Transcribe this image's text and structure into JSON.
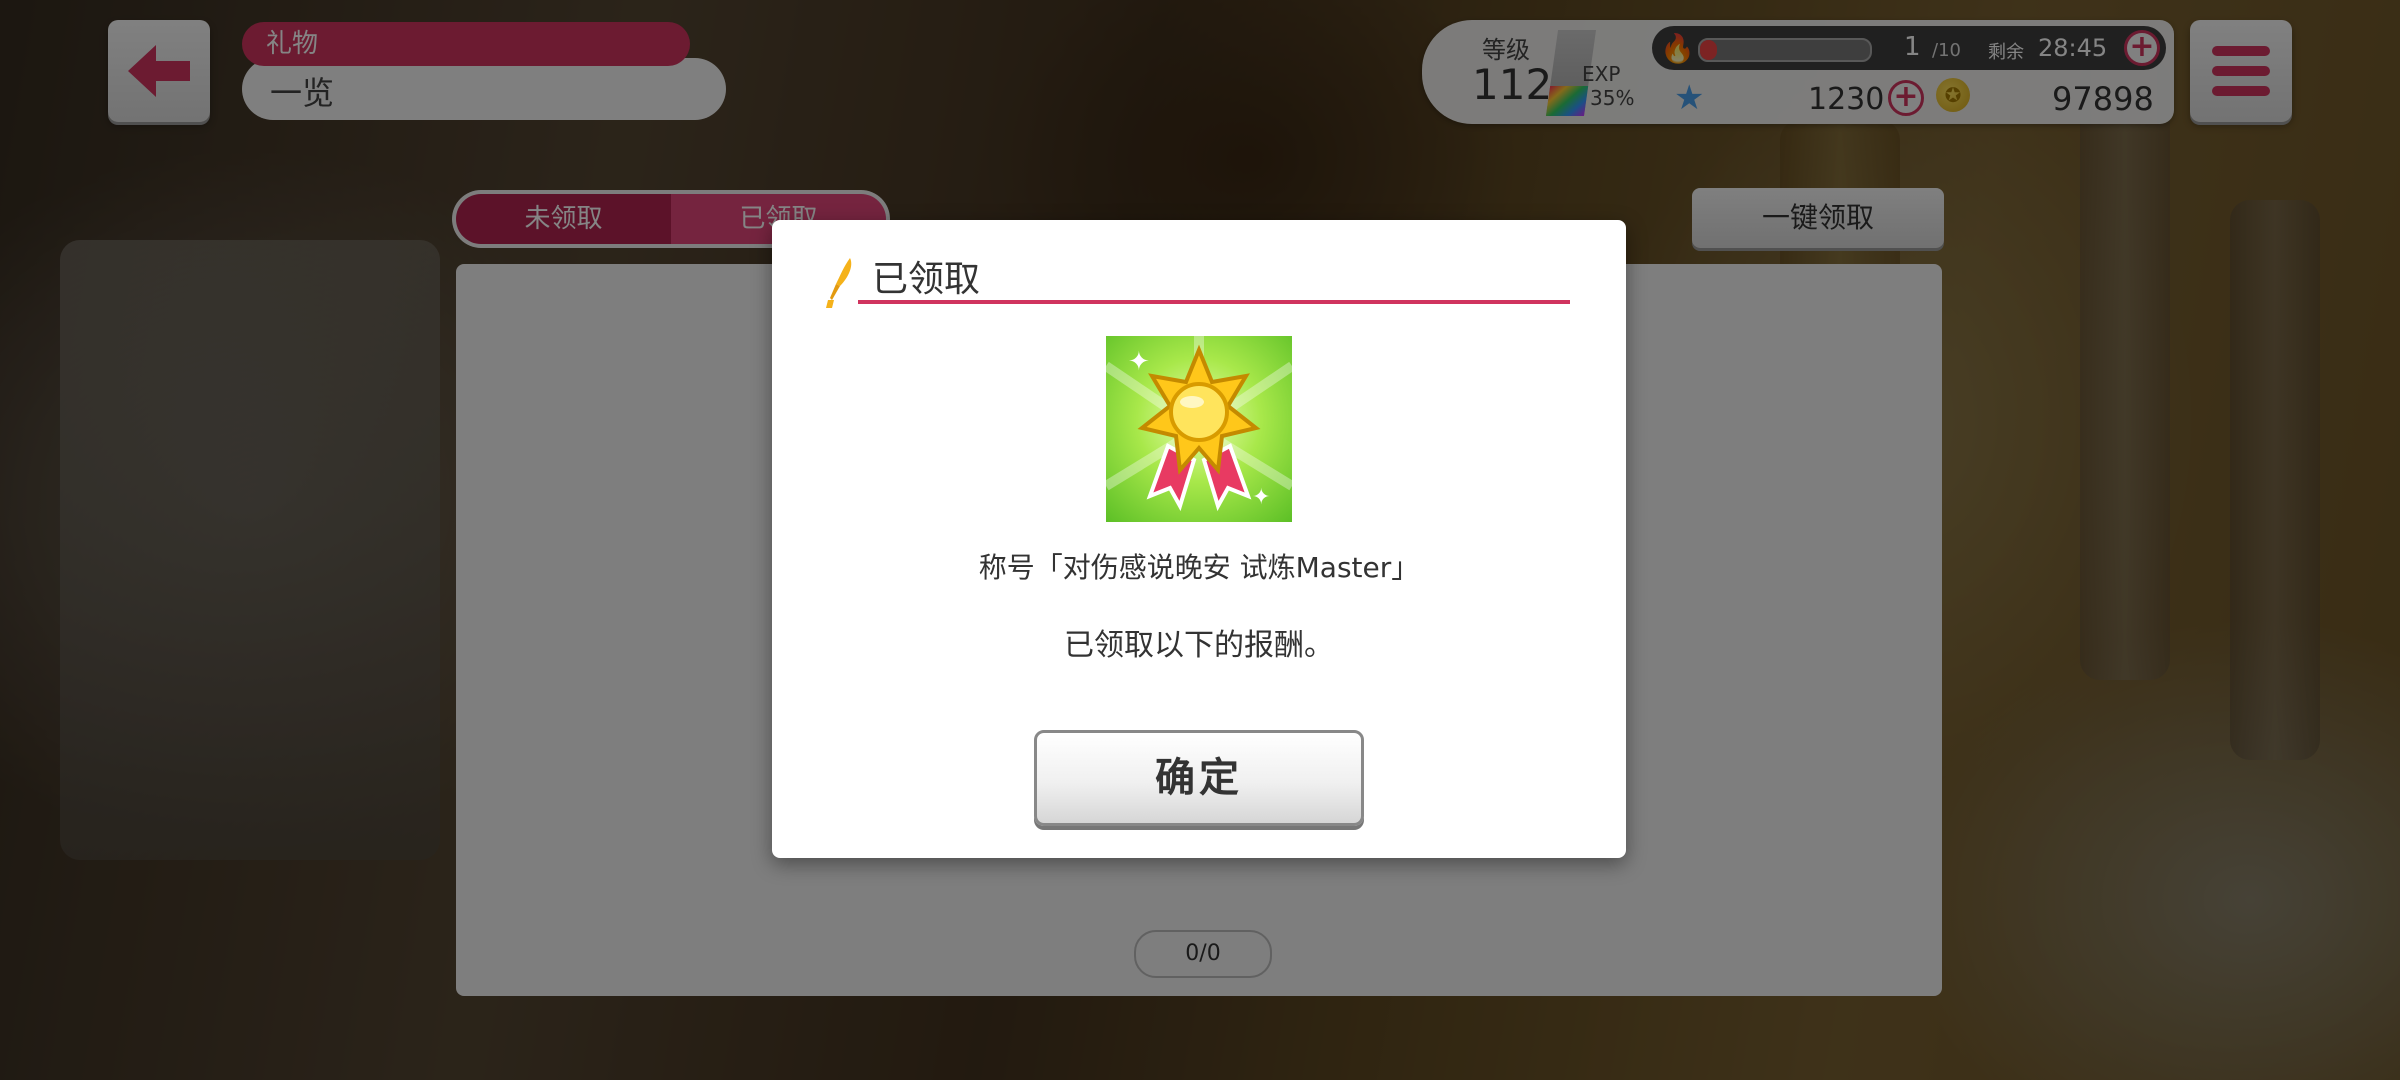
{
  "header": {
    "title": "礼物",
    "subtitle": "一览"
  },
  "status": {
    "level_label": "等级",
    "level_value": "112",
    "exp_label": "EXP",
    "exp_percent": "35%",
    "exp_fraction": 0.35,
    "stamina_current": "1",
    "stamina_max": "/10",
    "stamina_fraction": 0.1,
    "remain_label": "剩余",
    "timer": "28:45",
    "star_value": "1230",
    "coin_value": "97898"
  },
  "tabs": {
    "unclaimed": "未领取",
    "claimed": "已领取"
  },
  "claim_all_label": "一键领取",
  "pager": "0/0",
  "modal": {
    "title": "已领取",
    "reward_name": "称号「对伤感说晚安 试炼Master」",
    "message": "已领取以下的报酬。",
    "confirm_label": "确定"
  },
  "colors": {
    "accent": "#d0345f",
    "tab_active": "#b02350",
    "tab_inactive": "#e0457a"
  },
  "icons": {
    "back": "back-arrow-icon",
    "menu": "hamburger-menu-icon",
    "stamina": "fire-icon",
    "star": "star-icon",
    "coin": "coin-icon",
    "reward": "medal-icon",
    "title_mark": "quill-pen-icon"
  }
}
